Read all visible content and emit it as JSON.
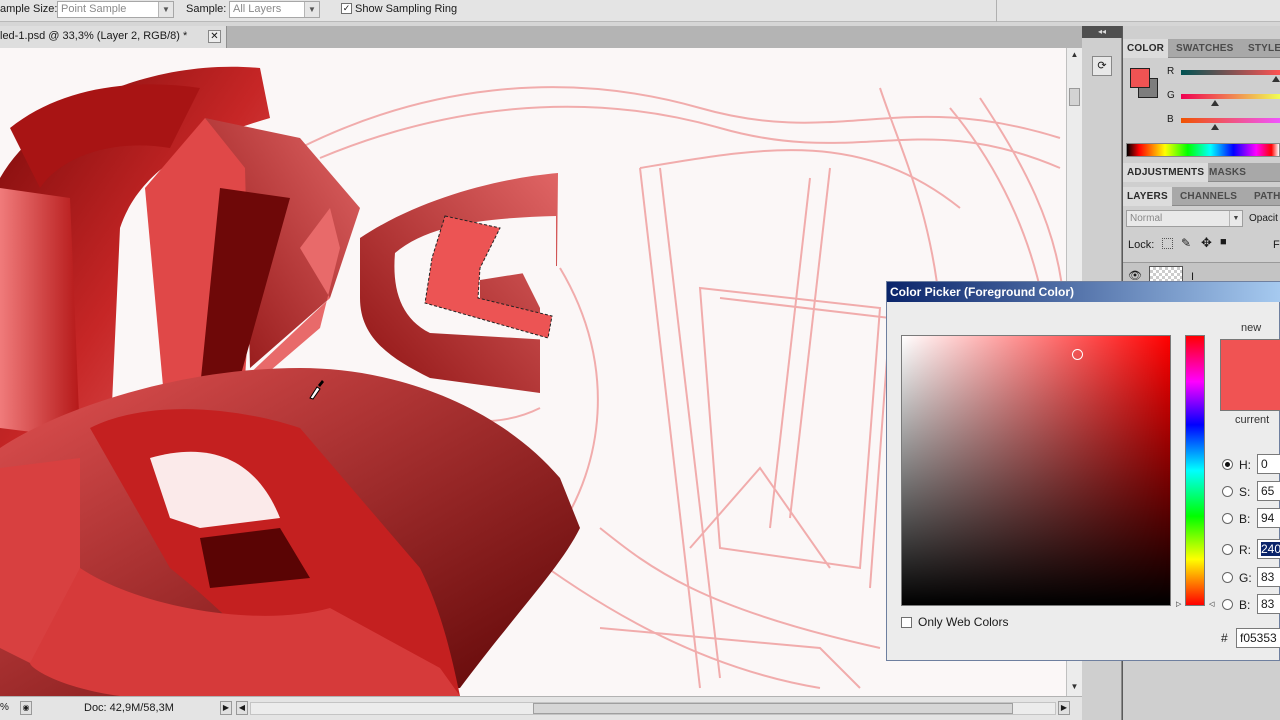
{
  "options_bar": {
    "sample_size_label": "ample Size:",
    "sample_size_value": "Point Sample",
    "sample_label": "Sample:",
    "sample_value": "All Layers",
    "show_ring_label": "Show Sampling Ring",
    "show_ring_checked": "✓"
  },
  "document": {
    "tab_title": "led-1.psd @ 33,3% (Layer 2, RGB/8) *",
    "close_glyph": "✕"
  },
  "status_bar": {
    "zoom": "%",
    "doc_info": "Doc: 42,9M/58,3M"
  },
  "color_panel": {
    "tabs": [
      "COLOR",
      "SWATCHES",
      "STYLE"
    ],
    "labels": [
      "R",
      "G",
      "B"
    ],
    "fg_color": "#f05353"
  },
  "adjustments_panel": {
    "tabs": [
      "ADJUSTMENTS",
      "MASKS"
    ]
  },
  "layers_panel": {
    "tabs": [
      "LAYERS",
      "CHANNELS",
      "PATH"
    ],
    "blend_mode": "Normal",
    "opacity_label": "Opacit",
    "lock_label": "Lock:",
    "fill_label": "F",
    "layer_name": "I"
  },
  "color_picker": {
    "title": "Color Picker (Foreground Color)",
    "new_label": "new",
    "current_label": "current",
    "new_color": "#f05353",
    "fields": [
      {
        "label": "H:",
        "value": "0",
        "checked": true
      },
      {
        "label": "S:",
        "value": "65",
        "checked": false
      },
      {
        "label": "B:",
        "value": "94",
        "checked": false
      },
      {
        "label": "R:",
        "value": "240",
        "checked": false
      },
      {
        "label": "G:",
        "value": "83",
        "checked": false
      },
      {
        "label": "B:",
        "value": "83",
        "checked": false
      }
    ],
    "only_web_colors": "Only Web Colors",
    "hash": "#",
    "hex": "f05353"
  }
}
